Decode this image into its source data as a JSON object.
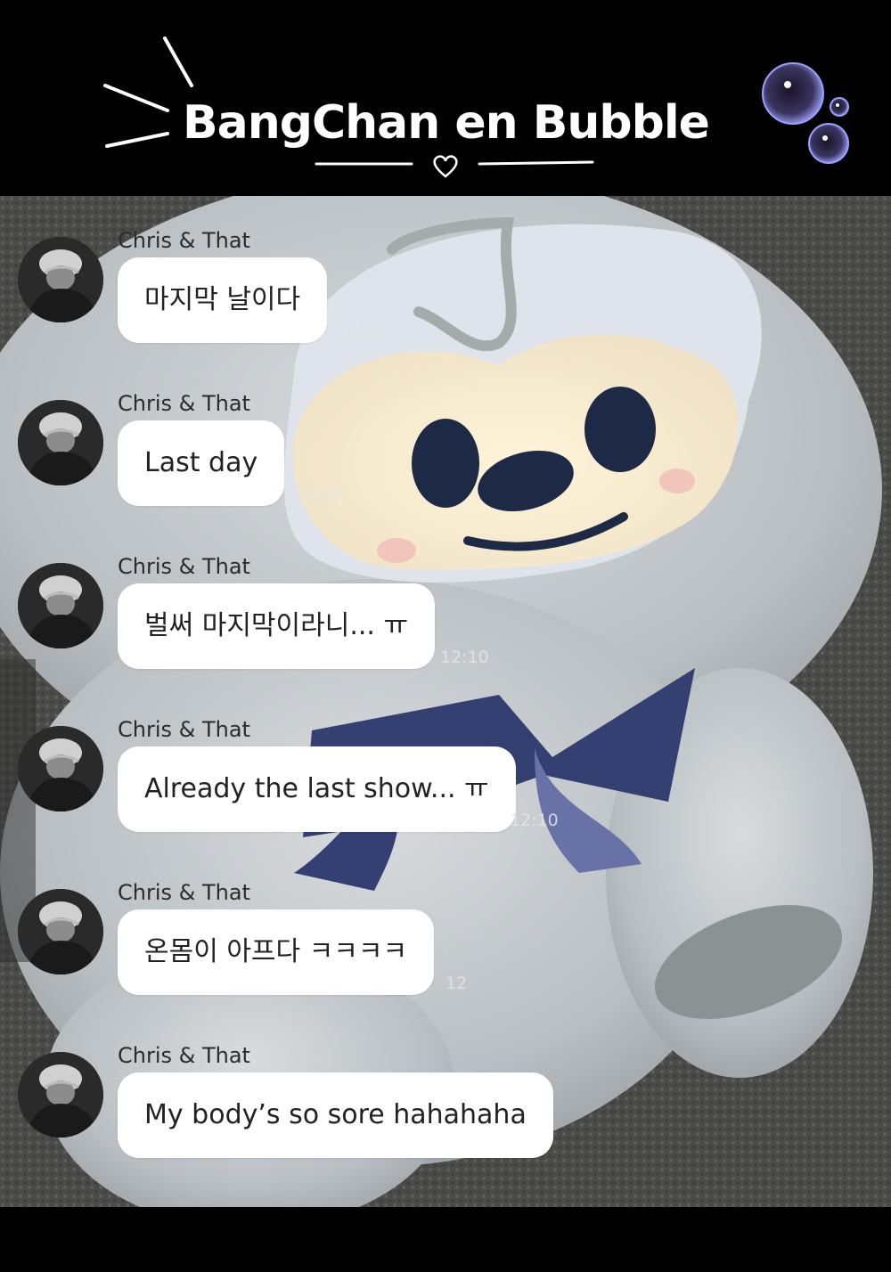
{
  "header": {
    "title": "BangChan en Bubble"
  },
  "messages": [
    {
      "sender": "Chris & That",
      "text": "마지막 날이다",
      "time": "12:09"
    },
    {
      "sender": "Chris & That",
      "text": "Last day",
      "time": "12:09"
    },
    {
      "sender": "Chris & That",
      "text": "벌써 마지막이라니... ㅠ",
      "time": "12:10"
    },
    {
      "sender": "Chris & That",
      "text": "Already the last show... ㅠ",
      "time": "12:10"
    },
    {
      "sender": "Chris & That",
      "text": "온몸이 아프다 ㅋㅋㅋㅋ",
      "time": "12"
    },
    {
      "sender": "Chris & That",
      "text": "My body’s so sore hahahaha",
      "time": ""
    }
  ],
  "icons": {
    "avatar": "profile-photo-icon",
    "bubbles": "bubble-decoration-icon",
    "heart": "heart-icon"
  }
}
